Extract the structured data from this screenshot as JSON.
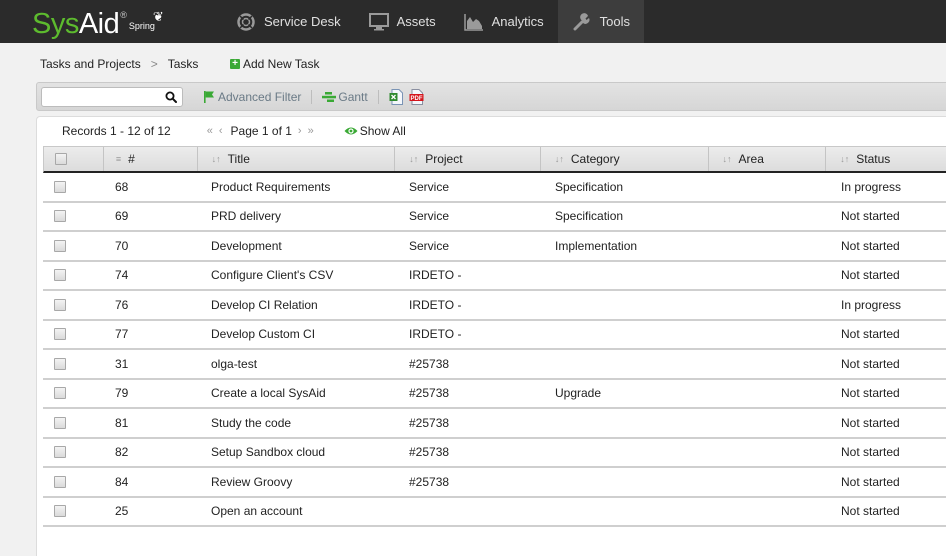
{
  "app": {
    "logo_part1": "Sys",
    "logo_part2": "Aid",
    "logo_reg": "®",
    "logo_edition": "Spring",
    "brand_color": "#5dbb2e"
  },
  "nav": {
    "items": [
      {
        "label": "Service Desk",
        "icon": "lifebuoy-icon"
      },
      {
        "label": "Assets",
        "icon": "monitor-icon"
      },
      {
        "label": "Analytics",
        "icon": "area-chart-icon"
      },
      {
        "label": "Tools",
        "icon": "wrench-icon",
        "active": true
      }
    ]
  },
  "breadcrumb": {
    "parent": "Tasks and Projects",
    "separator": ">",
    "current": "Tasks"
  },
  "actions": {
    "add_new_task": "Add New Task"
  },
  "toolbar": {
    "search_value": "",
    "search_placeholder": "",
    "advanced_filter": "Advanced Filter",
    "gantt": "Gantt",
    "export_excel": "excel-export-icon",
    "export_pdf": "pdf-export-icon"
  },
  "pager": {
    "records": "Records 1 - 12 of 12",
    "first": "«",
    "prev": "‹",
    "page_label": "Page 1 of 1",
    "next": "›",
    "last": "»",
    "show_all": "Show All"
  },
  "table": {
    "columns": [
      "#",
      "Title",
      "Project",
      "Category",
      "Area",
      "Status"
    ],
    "rows": [
      {
        "id": "68",
        "title": "Product Requirements",
        "project": "Service",
        "category": "Specification",
        "area": "",
        "status": "In progress"
      },
      {
        "id": "69",
        "title": "PRD delivery",
        "project": "Service",
        "category": "Specification",
        "area": "",
        "status": "Not started"
      },
      {
        "id": "70",
        "title": "Development",
        "project": "Service",
        "category": "Implementation",
        "area": "",
        "status": "Not started"
      },
      {
        "id": "74",
        "title": "Configure Client's CSV",
        "project": "IRDETO -",
        "category": "",
        "area": "",
        "status": "Not started"
      },
      {
        "id": "76",
        "title": "Develop CI Relation",
        "project": "IRDETO -",
        "category": "",
        "area": "",
        "status": "In progress"
      },
      {
        "id": "77",
        "title": "Develop Custom CI",
        "project": "IRDETO -",
        "category": "",
        "area": "",
        "status": "Not started"
      },
      {
        "id": "31",
        "title": "olga-test",
        "project": "#25738",
        "category": "",
        "area": "",
        "status": "Not started"
      },
      {
        "id": "79",
        "title": "Create a local SysAid",
        "project": "#25738",
        "category": "Upgrade",
        "area": "",
        "status": "Not started"
      },
      {
        "id": "81",
        "title": "Study the code",
        "project": "#25738",
        "category": "",
        "area": "",
        "status": "Not started"
      },
      {
        "id": "82",
        "title": "Setup Sandbox cloud",
        "project": "#25738",
        "category": "",
        "area": "",
        "status": "Not started"
      },
      {
        "id": "84",
        "title": "Review Groovy",
        "project": "#25738",
        "category": "",
        "area": "",
        "status": "Not started"
      },
      {
        "id": "25",
        "title": "Open an account",
        "project": "",
        "category": "",
        "area": "",
        "status": "Not started"
      }
    ]
  }
}
